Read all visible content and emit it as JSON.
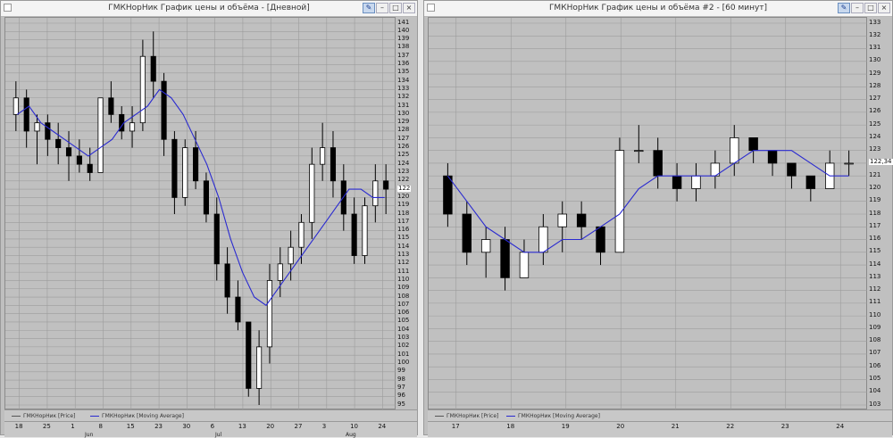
{
  "windows": [
    {
      "title": "ГМКНорНик График цены и объёма - [Дневной]",
      "y_labels": [
        "141",
        "140",
        "139",
        "138",
        "137",
        "136",
        "135",
        "134",
        "133",
        "132",
        "131",
        "130",
        "129",
        "128",
        "127",
        "126",
        "125",
        "124",
        "123",
        "122",
        "121",
        "120",
        "119",
        "118",
        "117",
        "116",
        "115",
        "114",
        "113",
        "112",
        "111",
        "110",
        "109",
        "108",
        "107",
        "106",
        "105",
        "104",
        "103",
        "102",
        "101",
        "100",
        "99",
        "98",
        "97",
        "96",
        "95"
      ],
      "current_price": "122",
      "legend": [
        "ГМКНорНик [Price]",
        "ГМКНорНик [Moving Average]"
      ],
      "x_labels": [
        "18",
        "25",
        "1",
        "8",
        "15",
        "23",
        "30",
        "6",
        "13",
        "20",
        "27",
        "3",
        "10",
        "24"
      ],
      "x_sub": [
        "Jun",
        "Jul",
        "Aug"
      ]
    },
    {
      "title": "ГМКНорНик График цены и объёма #2 - [60 минут]",
      "y_labels": [
        "133",
        "132",
        "131",
        "130",
        "129",
        "128",
        "127",
        "126",
        "125",
        "124",
        "123",
        "122",
        "121",
        "120",
        "119",
        "118",
        "117",
        "116",
        "115",
        "114",
        "113",
        "112",
        "111",
        "110",
        "109",
        "108",
        "107",
        "106",
        "105",
        "104",
        "103"
      ],
      "current_price": "122,34",
      "legend": [
        "ГМКНорНик [Price]",
        "ГМКНорНик [Moving Average]"
      ],
      "x_labels": [
        "17",
        "18",
        "19",
        "20",
        "21",
        "22",
        "23",
        "24"
      ],
      "x_sub": []
    }
  ],
  "colors": {
    "price": "#000000",
    "ma": "#2a2ad0",
    "grid": "#9c9c9c",
    "background": "#c0c0c0"
  },
  "chart_data": [
    {
      "type": "candlestick",
      "x": [
        "18",
        "25",
        "1",
        "8",
        "15",
        "23",
        "30",
        "6",
        "13",
        "20",
        "27",
        "3",
        "10",
        "24"
      ],
      "ylim": [
        95,
        141
      ],
      "grid": true,
      "legend_placement": "bottom",
      "series": [
        {
          "name": "ГМКНорНик [Price]",
          "values": [
            [
              130,
              134,
              128,
              132
            ],
            [
              132,
              133,
              126,
              128
            ],
            [
              128,
              130,
              124,
              129
            ],
            [
              129,
              130,
              125,
              127
            ],
            [
              127,
              129,
              124,
              126
            ],
            [
              126,
              128,
              122,
              125
            ],
            [
              125,
              127,
              123,
              124
            ],
            [
              124,
              126,
              122,
              123
            ],
            [
              123,
              130,
              123,
              132
            ],
            [
              132,
              134,
              129,
              130
            ],
            [
              130,
              131,
              127,
              128
            ],
            [
              128,
              131,
              126,
              129
            ],
            [
              129,
              139,
              128,
              137
            ],
            [
              137,
              140,
              132,
              134
            ],
            [
              134,
              135,
              125,
              127
            ],
            [
              127,
              128,
              118,
              120
            ],
            [
              120,
              127,
              119,
              126
            ],
            [
              126,
              128,
              121,
              122
            ],
            [
              122,
              123,
              117,
              118
            ],
            [
              118,
              120,
              110,
              112
            ],
            [
              112,
              114,
              106,
              108
            ],
            [
              108,
              110,
              104,
              105
            ],
            [
              105,
              104,
              96,
              97
            ],
            [
              97,
              104,
              95,
              102
            ],
            [
              102,
              112,
              100,
              110
            ],
            [
              110,
              114,
              108,
              112
            ],
            [
              112,
              116,
              110,
              114
            ],
            [
              114,
              118,
              112,
              117
            ],
            [
              117,
              126,
              115,
              124
            ],
            [
              124,
              129,
              122,
              126
            ],
            [
              126,
              128,
              120,
              122
            ],
            [
              122,
              124,
              116,
              118
            ],
            [
              118,
              120,
              112,
              113
            ],
            [
              113,
              120,
              112,
              119
            ],
            [
              119,
              124,
              117,
              122
            ],
            [
              122,
              124,
              118,
              121
            ]
          ]
        },
        {
          "name": "ГМКНорНик [Moving Average]",
          "values": [
            130,
            131,
            129,
            128,
            127,
            126,
            125,
            126,
            127,
            129,
            130,
            131,
            133,
            132,
            130,
            127,
            124,
            120,
            115,
            111,
            108,
            107,
            109,
            111,
            113,
            115,
            117,
            119,
            121,
            121,
            120,
            120
          ]
        }
      ]
    },
    {
      "type": "candlestick",
      "x": [
        "17",
        "18",
        "19",
        "20",
        "21",
        "22",
        "23",
        "24"
      ],
      "ylim": [
        103,
        133
      ],
      "grid": true,
      "legend_placement": "bottom",
      "series": [
        {
          "name": "ГМКНорНик [Price]",
          "values": [
            [
              121,
              122,
              117,
              118
            ],
            [
              118,
              119,
              114,
              115
            ],
            [
              115,
              117,
              113,
              116
            ],
            [
              116,
              117,
              112,
              113
            ],
            [
              113,
              116,
              113,
              115
            ],
            [
              115,
              118,
              114,
              117
            ],
            [
              117,
              119,
              115,
              118
            ],
            [
              118,
              119,
              116,
              117
            ],
            [
              117,
              116,
              114,
              115
            ],
            [
              115,
              124,
              115,
              123
            ],
            [
              123,
              125,
              122,
              123
            ],
            [
              123,
              124,
              120,
              121
            ],
            [
              121,
              122,
              119,
              120
            ],
            [
              120,
              122,
              119,
              121
            ],
            [
              121,
              123,
              120,
              122
            ],
            [
              122,
              125,
              121,
              124
            ],
            [
              124,
              124,
              122,
              123
            ],
            [
              123,
              123,
              121,
              122
            ],
            [
              122,
              122,
              120,
              121
            ],
            [
              121,
              121,
              119,
              120
            ],
            [
              120,
              123,
              120,
              122
            ],
            [
              122,
              123,
              121,
              122
            ]
          ]
        },
        {
          "name": "ГМКНорНик [Moving Average]",
          "values": [
            121,
            119,
            117,
            116,
            115,
            115,
            116,
            116,
            117,
            118,
            120,
            121,
            121,
            121,
            121,
            122,
            123,
            123,
            123,
            122,
            121,
            121
          ]
        }
      ]
    }
  ]
}
